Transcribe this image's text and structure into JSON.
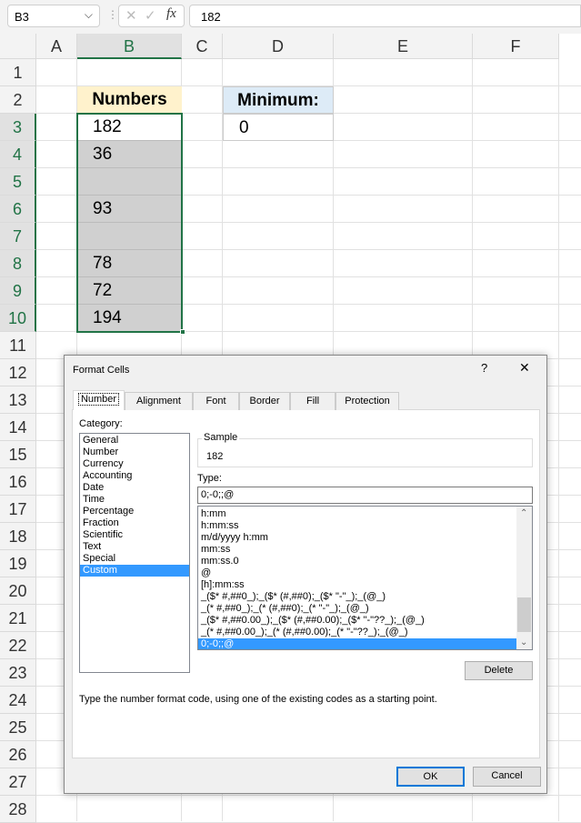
{
  "formula_bar": {
    "name_box": "B3",
    "cancel_icon": "x-icon",
    "enter_icon": "check-icon",
    "fx": "fx",
    "value": "182"
  },
  "columns": [
    "A",
    "B",
    "C",
    "D",
    "E",
    "F"
  ],
  "rows": [
    "1",
    "2",
    "3",
    "4",
    "5",
    "6",
    "7",
    "8",
    "9",
    "10",
    "11",
    "12",
    "13",
    "14",
    "15",
    "16",
    "17",
    "18",
    "19",
    "20",
    "21",
    "22",
    "23",
    "24",
    "25",
    "26",
    "27",
    "28"
  ],
  "sheet": {
    "numbers_header": "Numbers",
    "numbers": [
      "182",
      "36",
      "",
      "93",
      "",
      "78",
      "72",
      "194"
    ],
    "minimum_header": "Minimum:",
    "minimum_value": "0",
    "header_fill": "#fff2cc",
    "min_header_fill": "#ddebf7",
    "selected_fill": "#d0d0d0",
    "selection_border": "#217346"
  },
  "dialog": {
    "title": "Format Cells",
    "help": "?",
    "close": "✕",
    "tabs": [
      "Number",
      "Alignment",
      "Font",
      "Border",
      "Fill",
      "Protection"
    ],
    "category_label": "Category:",
    "categories": [
      "General",
      "Number",
      "Currency",
      "Accounting",
      "Date",
      "Time",
      "Percentage",
      "Fraction",
      "Scientific",
      "Text",
      "Special",
      "Custom"
    ],
    "selected_category": "Custom",
    "sample_label": "Sample",
    "sample_value": "182",
    "type_label": "Type:",
    "type_value": "0;-0;;@",
    "type_list": [
      "h:mm",
      "h:mm:ss",
      "m/d/yyyy h:mm",
      "mm:ss",
      "mm:ss.0",
      "@",
      "[h]:mm:ss",
      "_($* #,##0_);_($* (#,##0);_($* \"-\"_);_(@_)",
      "_(* #,##0_);_(* (#,##0);_(* \"-\"_);_(@_)",
      "_($* #,##0.00_);_($* (#,##0.00);_($* \"-\"??_);_(@_)",
      "_(* #,##0.00_);_(* (#,##0.00);_(* \"-\"??_);_(@_)",
      "0;-0;;@"
    ],
    "selected_type": "0;-0;;@",
    "delete_label": "Delete",
    "description": "Type the number format code, using one of the existing codes as a starting point.",
    "ok_label": "OK",
    "cancel_label": "Cancel",
    "selection_color": "#3399ff"
  }
}
